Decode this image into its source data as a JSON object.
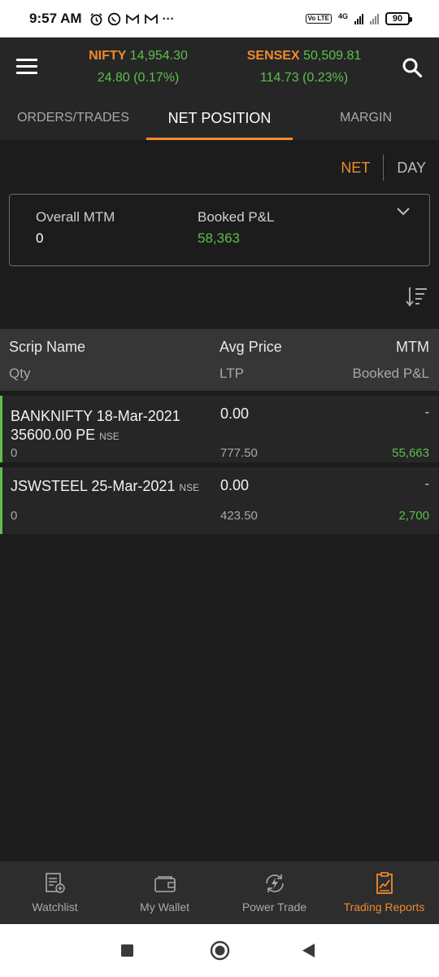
{
  "status_bar": {
    "time": "9:57 AM",
    "network": "4G",
    "volte": "Vo LTE",
    "battery": "90"
  },
  "header": {
    "nifty": {
      "name": "NIFTY",
      "value": "14,954.30",
      "change": "24.80 (0.17%)"
    },
    "sensex": {
      "name": "SENSEX",
      "value": "50,509.81",
      "change": "114.73 (0.23%)"
    }
  },
  "tabs": [
    {
      "label": "ORDERS/TRADES"
    },
    {
      "label": "NET POSITION"
    },
    {
      "label": "MARGIN"
    }
  ],
  "toggle": {
    "net": "NET",
    "day": "DAY"
  },
  "summary": {
    "overall_mtm_label": "Overall MTM",
    "overall_mtm_value": "0",
    "booked_pl_label": "Booked P&L",
    "booked_pl_value": "58,363"
  },
  "table_header": {
    "scrip_name": "Scrip Name",
    "avg_price": "Avg Price",
    "mtm": "MTM",
    "qty": "Qty",
    "ltp": "LTP",
    "booked_pl": "Booked P&L"
  },
  "positions": [
    {
      "scrip": "BANKNIFTY 18-Mar-2021 35600.00 PE",
      "exchange": "NSE",
      "avg_price": "0.00",
      "mtm": "-",
      "qty": "0",
      "ltp": "777.50",
      "booked_pl": "55,663"
    },
    {
      "scrip": "JSWSTEEL 25-Mar-2021",
      "exchange": "NSE",
      "avg_price": "0.00",
      "mtm": "-",
      "qty": "0",
      "ltp": "423.50",
      "booked_pl": "2,700"
    }
  ],
  "bottom_nav": [
    {
      "label": "Watchlist",
      "icon": "watchlist-icon"
    },
    {
      "label": "My Wallet",
      "icon": "wallet-icon"
    },
    {
      "label": "Power Trade",
      "icon": "power-trade-icon"
    },
    {
      "label": "Trading Reports",
      "icon": "trading-reports-icon"
    }
  ],
  "colors": {
    "accent": "#ef8b2c",
    "positive": "#5ebf4e",
    "background": "#1c1c1c"
  }
}
